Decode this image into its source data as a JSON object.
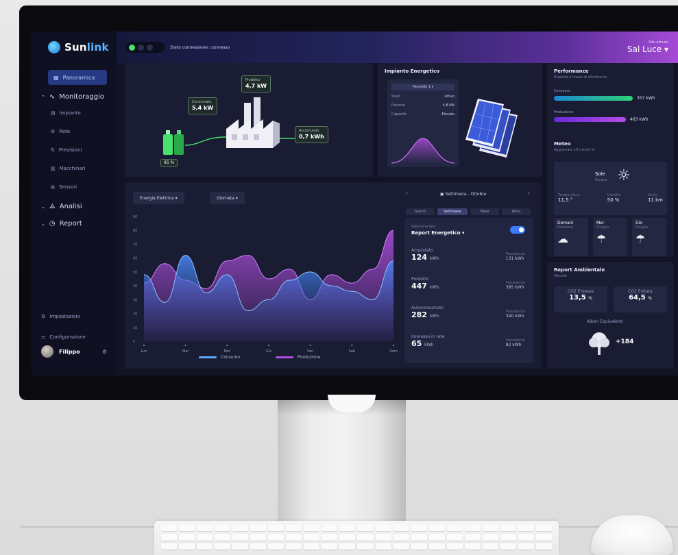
{
  "app": {
    "brand_prefix": "Sun",
    "brand_suffix": "link"
  },
  "sidebar": {
    "active_item": "Panoramica",
    "groups": [
      {
        "label": "Monitoraggio",
        "items": [
          "Impianto",
          "Rete",
          "Previsioni",
          "Macchinari",
          "Sensori"
        ]
      },
      {
        "label": "Analisi"
      },
      {
        "label": "Report"
      }
    ],
    "bottom": [
      "Impostazioni",
      "Configurazione"
    ],
    "user": "Filippo"
  },
  "topbar": {
    "status": "Stato connessione: connesso",
    "site_label": "Sito attuale",
    "site_name": "Sal Luce ▾"
  },
  "flow": {
    "consumo_label": "Consumato",
    "consumo_value": "5,4 kW",
    "prodotto_label": "Prodotto",
    "prodotto_value": "4,7 kW",
    "accumulo_label": "Accumulato",
    "accumulo_value": "0,7 kWh",
    "battery_pct": "95 %"
  },
  "impianto": {
    "title": "Impianto Energetico",
    "selector": "Pannello 1 ▾",
    "rows": [
      {
        "k": "Stato",
        "v": "Attivo"
      },
      {
        "k": "Potenza",
        "v": "4,8 kW"
      },
      {
        "k": "Capacità",
        "v": "Elevata"
      }
    ]
  },
  "performance": {
    "title": "Performance",
    "subtitle": "Rispetto al mese di riferimento",
    "rows": [
      {
        "label": "Consumo",
        "value": "357 kWh",
        "fill": 0.9,
        "color": "#2fd07a"
      },
      {
        "label": "Produzione",
        "value": "463 kWh",
        "fill": 0.82,
        "color": "#b34ee6"
      }
    ]
  },
  "meteo": {
    "title": "Meteo",
    "subtitle": "Aggiornato 10 minuti fa",
    "now_label": "Sole",
    "now_sub": "Sereno",
    "stats": [
      {
        "label": "Temperatura",
        "value": "11,5 °"
      },
      {
        "label": "Umidità",
        "value": "50 %"
      },
      {
        "label": "Vento",
        "value": "11 km"
      }
    ],
    "days": [
      {
        "name": "Domani",
        "desc": "Nuvoloso"
      },
      {
        "name": "Mer",
        "desc": "Pioggia"
      },
      {
        "name": "Gio",
        "desc": "Pioggia"
      }
    ]
  },
  "ambientale": {
    "title": "Report Ambientale",
    "subtitle": "Mensile",
    "co2_saved_label": "CO2 Emessa",
    "co2_saved_value": "13,5",
    "co2_saved_unit": "%",
    "co2_avoided_label": "CO2 Evitata",
    "co2_avoided_value": "64,5",
    "co2_avoided_unit": "%",
    "trees_label": "Alberi Equivalenti",
    "trees_value": "+184"
  },
  "chart_panel": {
    "dropdown_1": "Energia Elettrica ▾",
    "dropdown_2": "Giornata ▾",
    "period": "Settimana - Ottobre",
    "ranges": [
      "Giorno",
      "Settimana",
      "Mese",
      "Anno"
    ],
    "active_range": 1
  },
  "report_card": {
    "label": "Seleziona tipo",
    "title": "Report Energetico ▾",
    "rows": [
      {
        "label": "Acquistato",
        "value": "124",
        "unit": "kWh",
        "prev_label": "Precedente",
        "prev_value": "131 kWh"
      },
      {
        "label": "Prodotto",
        "value": "447",
        "unit": "kWh",
        "prev_label": "Precedente",
        "prev_value": "385 kWh"
      },
      {
        "label": "Autoconsumato",
        "value": "282",
        "unit": "kWh",
        "prev_label": "Precedente",
        "prev_value": "340 kWh"
      },
      {
        "label": "Immesso in rete",
        "value": "65",
        "unit": "kWh",
        "prev_label": "Precedente",
        "prev_value": "82 kWh"
      }
    ]
  },
  "chart_data": {
    "type": "area",
    "categories": [
      "Lun",
      "Mar",
      "Mer",
      "Gio",
      "Ven",
      "Sab",
      "Dom"
    ],
    "y_ticks": [
      0,
      10,
      20,
      30,
      40,
      50,
      60,
      70,
      80,
      90
    ],
    "ylim": [
      0,
      90
    ],
    "series": [
      {
        "name": "Consumo",
        "color": "#5aa8ff",
        "values": [
          48,
          28,
          62,
          35,
          48,
          22,
          30,
          44,
          50,
          40,
          36,
          30,
          58
        ]
      },
      {
        "name": "Produzione",
        "color": "#b04fe0",
        "values": [
          42,
          56,
          44,
          38,
          58,
          62,
          45,
          52,
          30,
          48,
          42,
          52,
          80
        ]
      }
    ],
    "legend": "bottom"
  },
  "colors": {
    "accent": "#3a7bff",
    "produzione": "#b04fe0",
    "consumo": "#5aa8ff",
    "green": "#47e06d"
  },
  "icons": {
    "brand": "sunlink-logo-icon",
    "monitor": "activity-icon",
    "analisi": "chart-icon",
    "report": "clock-icon",
    "sun": "sun-icon",
    "cloud": "cloud-icon",
    "rain": "rain-cloud-icon",
    "tree": "tree-icon"
  }
}
